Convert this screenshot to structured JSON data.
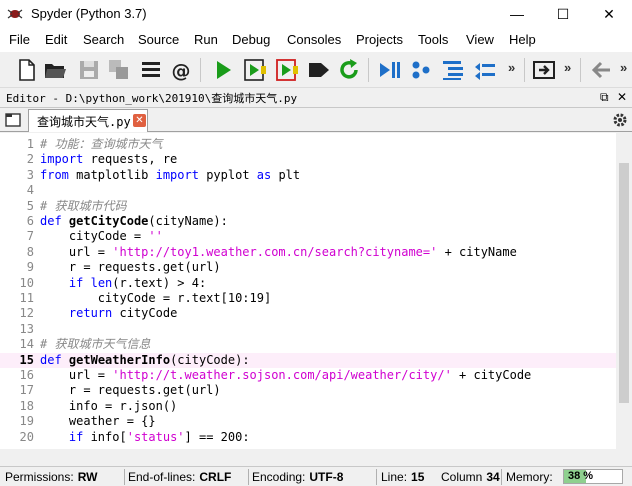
{
  "window": {
    "title": "Spyder (Python 3.7)",
    "minimize_glyph": "—",
    "maximize_glyph": "☐",
    "close_glyph": "✕"
  },
  "menu": [
    "File",
    "Edit",
    "Search",
    "Source",
    "Run",
    "Debug",
    "Consoles",
    "Projects",
    "Tools",
    "View",
    "Help"
  ],
  "toolbar": {
    "icons": [
      "new-file-icon",
      "open-folder-icon",
      "save-icon",
      "save-all-icon",
      "list-icon",
      "at-icon",
      "run-icon",
      "run-cell-icon",
      "run-cell-advance-icon",
      "run-selection-icon",
      "rerun-icon",
      "step-debug-icon",
      "debug-cells-icon",
      "indent-icon",
      "outdent-icon",
      "maximize-pane-icon",
      "back-arrow-icon"
    ],
    "more_glyph": "»"
  },
  "editor": {
    "header": "Editor - D:\\python_work\\201910\\查询城市天气.py",
    "tab_label": "查询城市天气.py",
    "tab_close": "✕",
    "undock_glyph": "⧉",
    "close_glyph": "✕",
    "current_line": 15,
    "lines": [
      {
        "n": "1",
        "text": "# 功能：查询城市天气"
      },
      {
        "n": "2",
        "text": "import requests, re"
      },
      {
        "n": "3",
        "text": "from matplotlib import pyplot as plt"
      },
      {
        "n": "4",
        "text": ""
      },
      {
        "n": "5",
        "text": "# 获取城市代码"
      },
      {
        "n": "6",
        "text": "def getCityCode(cityName):"
      },
      {
        "n": "7",
        "text": "    cityCode = ''"
      },
      {
        "n": "8",
        "text": "    url = 'http://toy1.weather.com.cn/search?cityname=' + cityName"
      },
      {
        "n": "9",
        "text": "    r = requests.get(url)"
      },
      {
        "n": "10",
        "text": "    if len(r.text) > 4:"
      },
      {
        "n": "11",
        "text": "        cityCode = r.text[10:19]"
      },
      {
        "n": "12",
        "text": "    return cityCode"
      },
      {
        "n": "13",
        "text": ""
      },
      {
        "n": "14",
        "text": "# 获取城市天气信息"
      },
      {
        "n": "15",
        "text": "def getWeatherInfo(cityCode):"
      },
      {
        "n": "16",
        "text": "    url = 'http://t.weather.sojson.com/api/weather/city/' + cityCode"
      },
      {
        "n": "17",
        "text": "    r = requests.get(url)"
      },
      {
        "n": "18",
        "text": "    info = r.json()"
      },
      {
        "n": "19",
        "text": "    weather = {}"
      },
      {
        "n": "20",
        "text": "    if info['status'] == 200:"
      }
    ]
  },
  "status": {
    "permissions_label": "Permissions:",
    "permissions_value": "RW",
    "eol_label": "End-of-lines:",
    "eol_value": "CRLF",
    "encoding_label": "Encoding:",
    "encoding_value": "UTF-8",
    "line_label": "Line:",
    "line_value": "15",
    "column_label": "Column",
    "column_value": "34",
    "memory_label": "Memory:",
    "memory_value": "38 %",
    "memory_fraction": 0.38
  },
  "colors": {
    "keyword": "#0000ff",
    "string": "#d000d0",
    "comment": "#888888",
    "current_line_bg": "#fdeefa",
    "run_green": "#1a9c1a",
    "toolbar_blue": "#1e6fc8"
  }
}
